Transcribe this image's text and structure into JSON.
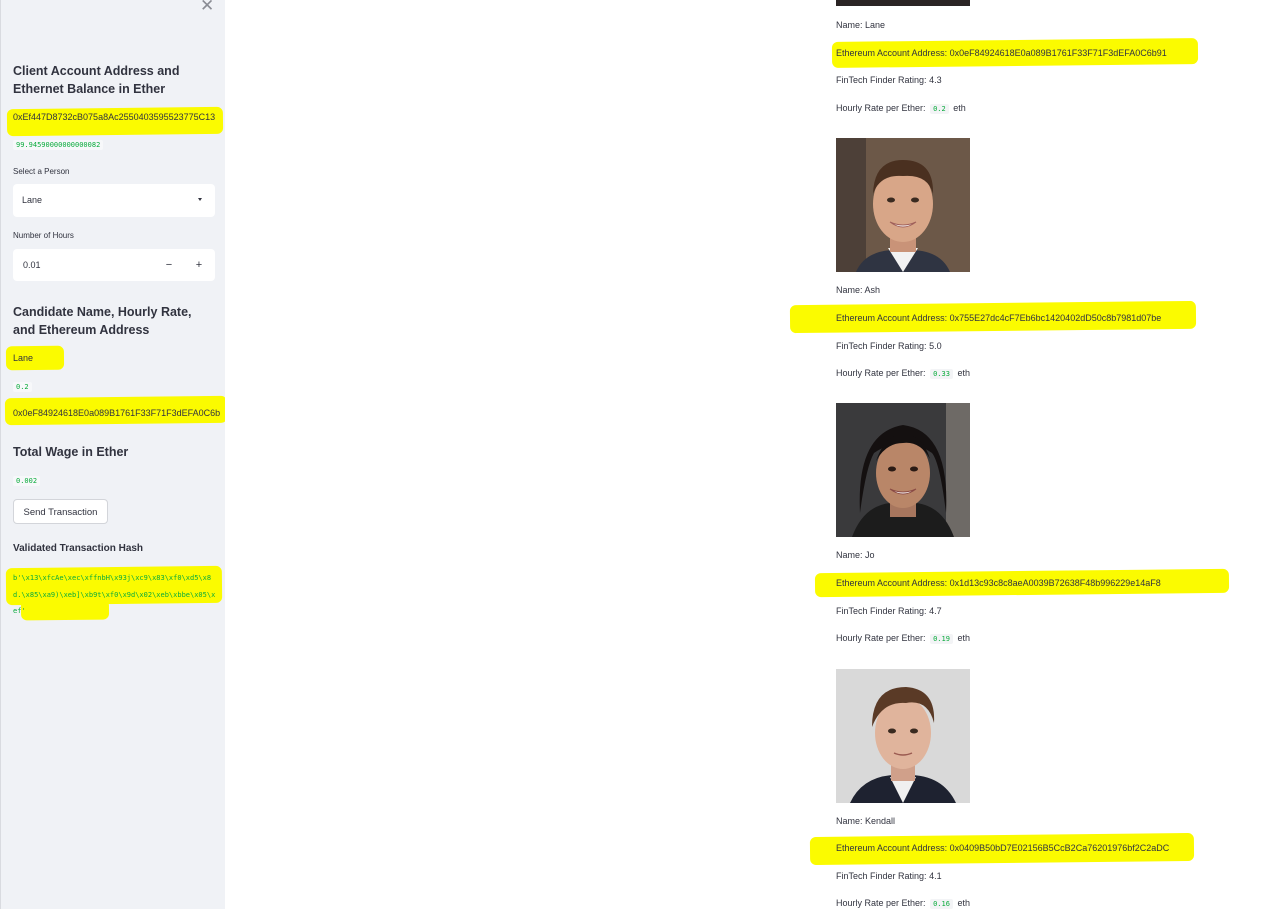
{
  "sidebar": {
    "close_icon": "close-icon",
    "client_heading": "Client Account Address and Ethernet Balance in Ether",
    "client_address": "0xEf447D8732cB075a8Ac2550403595523775C13",
    "client_balance": "99.94590000000000082",
    "select_label": "Select a Person",
    "select_value": "Lane",
    "hours_label": "Number of Hours",
    "hours_value": "0.01",
    "minus": "−",
    "plus": "+",
    "candidate_heading": "Candidate Name, Hourly Rate, and Ethereum Address",
    "candidate_name": "Lane",
    "candidate_rate": "0.2",
    "candidate_address": "0x0eF84924618E0a089B1761F33F71F3dEFA0C6b",
    "wage_heading": "Total Wage in Ether",
    "wage_value": "0.002",
    "send_button": "Send Transaction",
    "hash_heading": "Validated Transaction Hash",
    "hash_value": "b'\\x13\\xfcAe\\xec\\xffnbH\\x93j\\xc9\\x83\\xf0\\xd5\\x8d.\\x85\\xa9)\\xeb]\\xb9t\\xf0\\x9d\\x02\\xeb\\xbbe\\x05\\xef'"
  },
  "main": {
    "name_prefix": "Name:",
    "address_prefix": "Ethereum Account Address:",
    "rating_prefix": "FinTech Finder Rating:",
    "rate_prefix": "Hourly Rate per Ether:",
    "rate_unit": "eth",
    "candidates": [
      {
        "name": "Lane",
        "address": "0x0eF84924618E0a089B1761F33F71F3dEFA0C6b91",
        "rating": "4.3",
        "rate": "0.2"
      },
      {
        "name": "Ash",
        "address": "0x755E27dc4cF7Eb6bc1420402dD50c8b7981d07be",
        "rating": "5.0",
        "rate": "0.33"
      },
      {
        "name": "Jo",
        "address": "0x1d13c93c8c8aeA0039B72638F48b996229e14aF8",
        "rating": "4.7",
        "rate": "0.19"
      },
      {
        "name": "Kendall",
        "address": "0x0409B50bD7E02156B5CcB2Ca76201976bf2C2aDC",
        "rating": "4.1",
        "rate": "0.16"
      }
    ]
  },
  "colors": {
    "highlight": "#fbfb00",
    "sidebar_bg": "#f0f2f6",
    "code_green": "#09ab3b"
  }
}
